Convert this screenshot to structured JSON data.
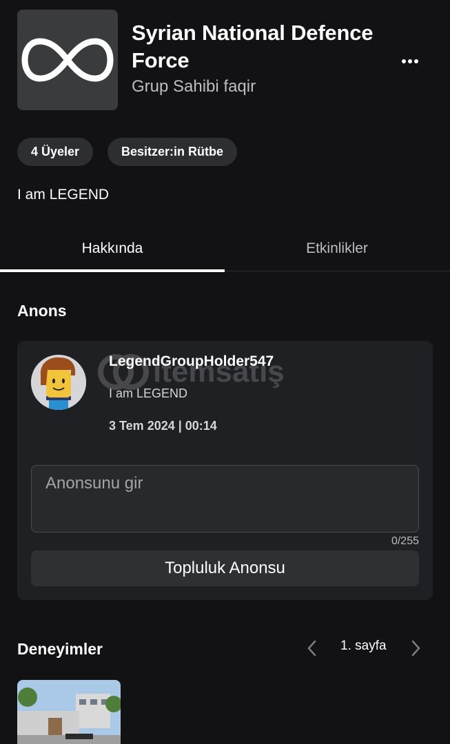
{
  "group": {
    "name": "Syrian National Defence Force",
    "owner": "Grup Sahibi faqir",
    "description": "I am LEGEND",
    "logo_icon": "infinity-icon"
  },
  "chips": {
    "members": "4 Üyeler",
    "rank": "Besitzer:in Rütbe"
  },
  "tabs": [
    {
      "label": "Hakkında",
      "active": true
    },
    {
      "label": "Etkinlikler",
      "active": false
    }
  ],
  "announcement": {
    "section_title": "Anons",
    "poster_name": "LegendGroupHolder547",
    "body": "I am LEGEND",
    "date": "3 Tem 2024 | 00:14",
    "input_placeholder": "Anonsunu gir",
    "char_count": "0/255",
    "button_label": "Topluluk Anonsu",
    "watermark_text": "itemsatış"
  },
  "experiences": {
    "section_title": "Deneyimler",
    "page_label": "1. sayfa"
  },
  "colors": {
    "background": "#121214",
    "card": "#1f2023",
    "chip": "#2c2e31",
    "button": "#2f3034"
  }
}
